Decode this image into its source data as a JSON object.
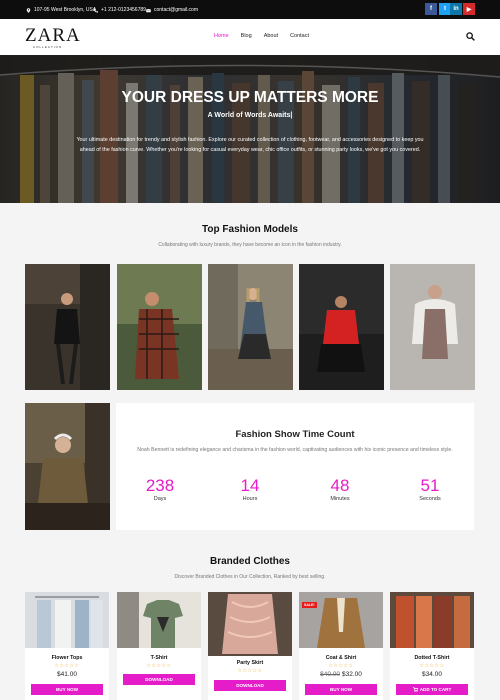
{
  "topbar": {
    "address": "107-95 West Brooklyn, USA",
    "phone": "+1 212-0123456789",
    "email": "contact@gmail.com",
    "social": [
      {
        "icon": "facebook-icon",
        "glyph": "f",
        "color": "#3b5998"
      },
      {
        "icon": "twitter-icon",
        "glyph": "t",
        "color": "#1da1f2"
      },
      {
        "icon": "linkedin-icon",
        "glyph": "in",
        "color": "#0e76a8"
      },
      {
        "icon": "youtube-icon",
        "glyph": "▶",
        "color": "#d42a2a"
      }
    ]
  },
  "header": {
    "logo": "ZARA",
    "logo_sub": "COLLECTION",
    "nav": [
      "Home",
      "Blog",
      "About",
      "Contact"
    ],
    "active_nav": "Home"
  },
  "hero": {
    "title": "YOUR DRESS UP MATTERS MORE",
    "subtitle": "A World of Words Awaits|",
    "description": "Your ultimate destination for trendy and stylish fashion. Explore our curated collection of clothing, footwear, and accessories designed to keep you ahead of the fashion curve. Whether you're looking for casual everyday wear, chic office outfits, or stunning party looks, we've got you covered."
  },
  "models": {
    "title": "Top Fashion Models",
    "subtitle": "Collaborating with luxury brands, they have become an icon in the fashion industry."
  },
  "countdown": {
    "title": "Fashion Show Time Count",
    "description": "Noah Bennett is redefining elegance and charisma in the fashion world, captivating audiences with his iconic presence and timeless style.",
    "items": [
      {
        "value": "238",
        "label": "Days"
      },
      {
        "value": "14",
        "label": "Hours"
      },
      {
        "value": "48",
        "label": "Minutes"
      },
      {
        "value": "51",
        "label": "Seconds"
      }
    ]
  },
  "branded": {
    "title": "Branded Clothes",
    "subtitle": "Discover Branded Clothes in Our Collection, Ranked by best selling.",
    "products": [
      {
        "name": "Flower Tops",
        "price": "$41.00",
        "old_price": "",
        "button": "BUY NOW",
        "stars": "☆☆☆☆☆",
        "sale": ""
      },
      {
        "name": "T-Shirt",
        "price": "",
        "old_price": "",
        "button": "DOWNLOAD",
        "stars": "☆☆☆☆☆",
        "sale": ""
      },
      {
        "name": "Party Skirt",
        "price": "",
        "old_price": "",
        "button": "DOWNLOAD",
        "stars": "☆☆☆☆☆",
        "sale": ""
      },
      {
        "name": "Coat & Shirt",
        "price": "$32.00",
        "old_price": "$40.00",
        "button": "BUY NOW",
        "stars": "☆☆☆☆☆",
        "sale": "SALE!"
      },
      {
        "name": "Dotted T-Shirt",
        "price": "$34.00",
        "old_price": "",
        "button": "ADD TO CART",
        "stars": "☆☆☆☆☆",
        "sale": ""
      }
    ]
  },
  "colors": {
    "accent": "#e51dc8",
    "topbar": "#0d0d0d",
    "sale": "#e31b1b",
    "stars": "#f0a31c"
  }
}
